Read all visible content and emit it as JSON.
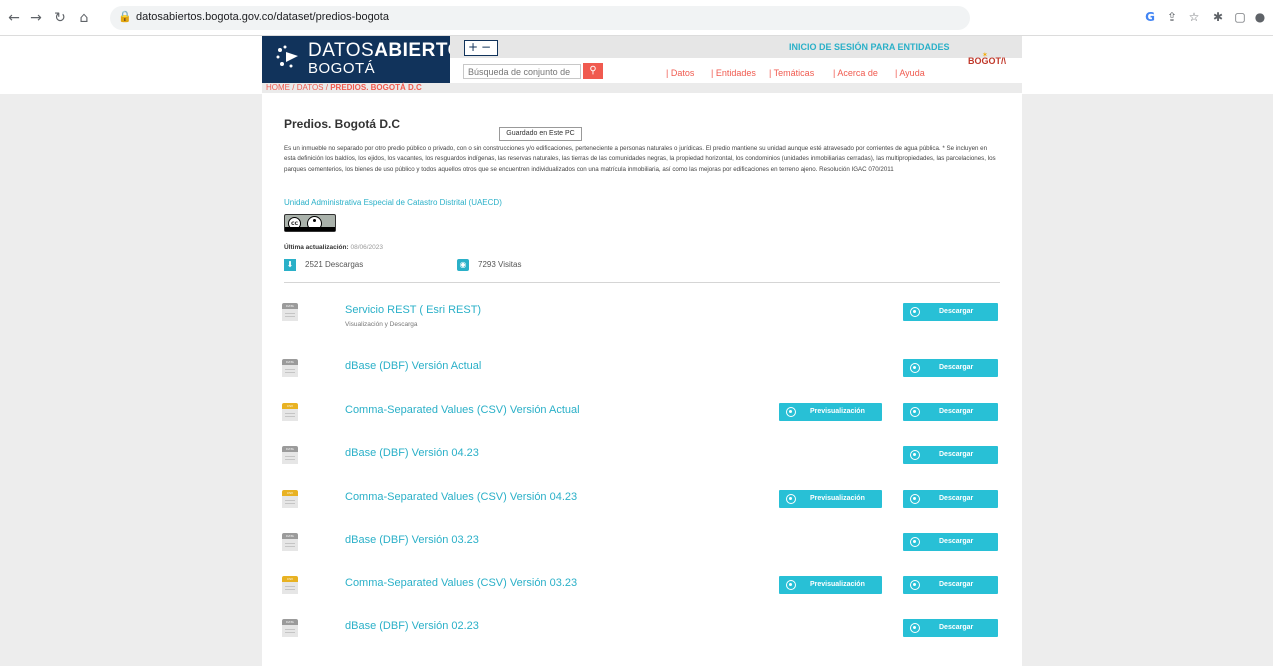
{
  "browser": {
    "url": "datosabiertos.bogota.gov.co/dataset/predios-bogota"
  },
  "header": {
    "logo_title_light": "DATOS",
    "logo_title_bold": "ABIERTOS",
    "logo_subtitle": "BOGOTÁ",
    "zoom_label": "+−",
    "login_label": "INICIO DE SESIÓN PARA ENTIDADES",
    "search_placeholder": "Búsqueda de conjunto de",
    "nav": [
      "| Datos",
      "| Entidades",
      "| Temáticas",
      "| Acerca de",
      "| Ayuda"
    ],
    "brand": "BOGOT/\\"
  },
  "breadcrumb": {
    "home": "HOME",
    "datos": "DATOS",
    "current": "PREDIOS. BOGOTÁ D.C"
  },
  "dataset": {
    "title": "Predios. Bogotá D.C",
    "tooltip": "Guardado en Este PC",
    "description": "Es un inmueble no separado por otro predio público o privado, con o sin construcciones y/o edificaciones, perteneciente a personas naturales o jurídicas. El predio mantiene su unidad aunque esté atravesado por corrientes de agua pública. * Se incluyen en esta definición los baldíos, los ejidos, los vacantes, los resguardos indígenas, las reservas naturales, las tierras de las comunidades negras, la propiedad horizontal, los condominios (unidades inmobiliarias cerradas), las multipropiedades, las parcelaciones, los parques cementerios, los bienes de uso público y todos aquellos otros que se encuentren individualizados con una matrícula inmobiliaria, así como las mejoras por edificaciones en terreno ajeno. Resolución IGAC 070/2011",
    "organization": "Unidad Administrativa Especial de Catastro Distrital (UAECD)",
    "updated_label": "Última actualización:",
    "updated_date": "08/06/2023",
    "downloads": "2521 Descargas",
    "visits": "7293 Visitas"
  },
  "labels": {
    "download": "Descargar",
    "preview": "Previsualización"
  },
  "resources": [
    {
      "title": "Servicio REST ( Esri REST)",
      "subtitle": "Visualización y Descarga",
      "format": "DATA",
      "color": "#9b9b9b",
      "preview": false
    },
    {
      "title": "dBase (DBF) Versión Actual",
      "subtitle": "",
      "format": "DATA",
      "color": "#9b9b9b",
      "preview": false
    },
    {
      "title": "Comma-Separated Values (CSV) Versión Actual",
      "subtitle": "",
      "format": "CSV",
      "color": "#e8b223",
      "preview": true
    },
    {
      "title": "dBase (DBF) Versión 04.23",
      "subtitle": "",
      "format": "DATA",
      "color": "#9b9b9b",
      "preview": false
    },
    {
      "title": "Comma-Separated Values (CSV) Versión 04.23",
      "subtitle": "",
      "format": "CSV",
      "color": "#e8b223",
      "preview": true
    },
    {
      "title": "dBase (DBF) Versión 03.23",
      "subtitle": "",
      "format": "DATA",
      "color": "#9b9b9b",
      "preview": false
    },
    {
      "title": "Comma-Separated Values (CSV) Versión 03.23",
      "subtitle": "",
      "format": "CSV",
      "color": "#e8b223",
      "preview": true
    },
    {
      "title": "dBase (DBF) Versión 02.23",
      "subtitle": "",
      "format": "DATA",
      "color": "#9b9b9b",
      "preview": false
    }
  ],
  "colors": {
    "accent": "#2ab0c8",
    "button": "#28c0d6",
    "brand_red": "#f05a4f",
    "navy": "#11335b"
  }
}
